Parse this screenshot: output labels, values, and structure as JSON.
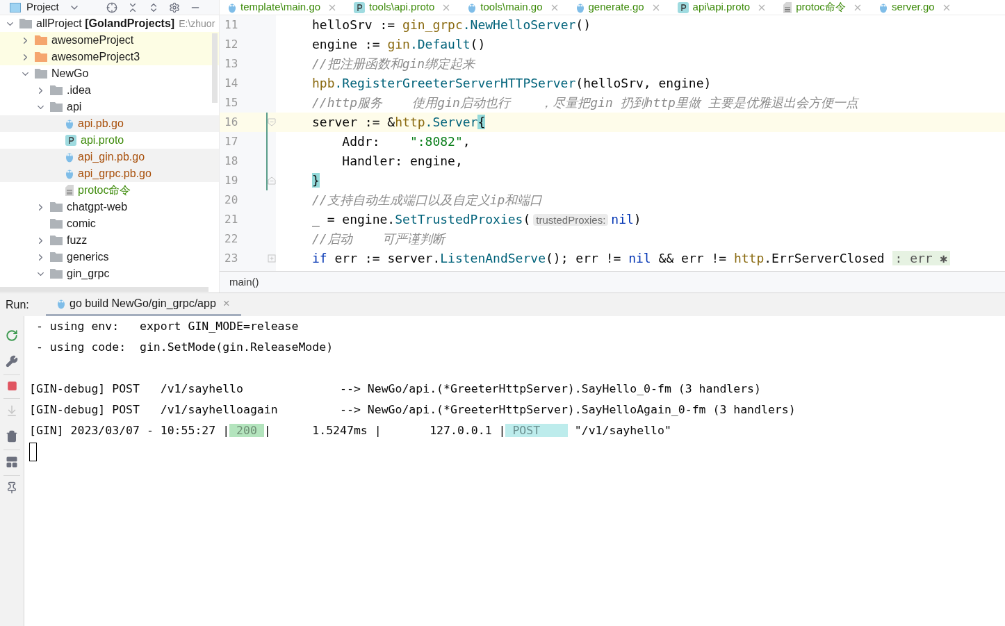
{
  "project_toolbar": {
    "title": "Project"
  },
  "editor_tabs": [
    {
      "label": "template\\main.go",
      "kind": "go",
      "color": "#3d8b0a"
    },
    {
      "label": "tools\\api.proto",
      "kind": "proto",
      "color": "#3d8b0a"
    },
    {
      "label": "tools\\main.go",
      "kind": "go",
      "color": "#3d8b0a"
    },
    {
      "label": "generate.go",
      "kind": "go",
      "color": "#3d8b0a"
    },
    {
      "label": "api\\api.proto",
      "kind": "proto",
      "color": "#3d8b0a"
    },
    {
      "label": "protoc命令",
      "kind": "text",
      "color": "#3d8b0a"
    },
    {
      "label": "server.go",
      "kind": "go",
      "color": "#3d8b0a"
    }
  ],
  "project_tree": [
    {
      "label": "allProject **[GolandProjects]**",
      "path": "E:\\zhuor",
      "kind": "folder",
      "expanded": true,
      "children": [
        {
          "label": "awesomeProject",
          "kind": "module",
          "expanded": false
        },
        {
          "label": "awesomeProject3",
          "kind": "module",
          "expanded": false
        },
        {
          "label": "NewGo",
          "kind": "folder",
          "expanded": true,
          "children": [
            {
              "label": ".idea",
              "kind": "folder",
              "expanded": false
            },
            {
              "label": "api",
              "kind": "folder",
              "expanded": true,
              "children": [
                {
                  "label": "api.pb.go",
                  "kind": "go",
                  "color": "#a84f0a",
                  "highlighted": true
                },
                {
                  "label": "api.proto",
                  "kind": "proto",
                  "color": "#3d8b0a",
                  "highlighted": false
                },
                {
                  "label": "api_gin.pb.go",
                  "kind": "go",
                  "color": "#a84f0a",
                  "highlighted": true
                },
                {
                  "label": "api_grpc.pb.go",
                  "kind": "go",
                  "color": "#a84f0a",
                  "highlighted": true
                },
                {
                  "label": "protoc命令",
                  "kind": "text",
                  "color": "#3d8b0a",
                  "highlighted": false
                }
              ]
            },
            {
              "label": "chatgpt-web",
              "kind": "folder",
              "expanded": false
            },
            {
              "label": "comic",
              "kind": "folder"
            },
            {
              "label": "fuzz",
              "kind": "folder",
              "expanded": false
            },
            {
              "label": "generics",
              "kind": "folder",
              "expanded": false
            },
            {
              "label": "gin_grpc",
              "kind": "folder",
              "expanded": true
            }
          ]
        }
      ]
    }
  ],
  "code_lines": [
    {
      "number": "11",
      "kind": "code",
      "current": false,
      "changed": false,
      "tokens": [
        {
          "t": "helloSrv := ",
          "kind": "plain"
        },
        {
          "t": "gin_grpc",
          "kind": "pkg"
        },
        {
          "t": ".NewHelloServer",
          "kind": "fn"
        },
        {
          "t": "()",
          "kind": "plain"
        }
      ]
    },
    {
      "number": "12",
      "kind": "code",
      "current": false,
      "changed": false,
      "tokens": [
        {
          "t": "engine := ",
          "kind": "plain"
        },
        {
          "t": "gin",
          "kind": "pkg"
        },
        {
          "t": ".Default",
          "kind": "fn"
        },
        {
          "t": "()",
          "kind": "plain"
        }
      ]
    },
    {
      "number": "13",
      "kind": "code",
      "current": false,
      "changed": false,
      "tokens": [
        {
          "t": "//把注册函数和gin绑定起来",
          "kind": "comment"
        }
      ]
    },
    {
      "number": "14",
      "kind": "code",
      "current": false,
      "changed": false,
      "tokens": [
        {
          "t": "hpb",
          "kind": "pkg"
        },
        {
          "t": ".RegisterGreeterServerHTTPServer",
          "kind": "fn"
        },
        {
          "t": "(helloSrv, engine)",
          "kind": "plain"
        }
      ]
    },
    {
      "number": "15",
      "kind": "code",
      "current": false,
      "changed": false,
      "tokens": [
        {
          "t": "//http服务    使用gin启动也行    ，尽量把gin 扔到http里做 主要是优雅退出会方便一点",
          "kind": "comment"
        }
      ]
    },
    {
      "number": "16",
      "kind": "fold-start",
      "current": true,
      "changed": true,
      "tokens": [
        {
          "t": "server := &",
          "kind": "plain"
        },
        {
          "t": "http",
          "kind": "pkg"
        },
        {
          "t": ".Server",
          "kind": "fn"
        },
        {
          "t": "{",
          "kind": "brace"
        }
      ]
    },
    {
      "number": "17",
      "kind": "code",
      "current": false,
      "changed": true,
      "tokens": [
        {
          "t": "    Addr:    ",
          "kind": "plain"
        },
        {
          "t": "\":8082\"",
          "kind": "string"
        },
        {
          "t": ",",
          "kind": "plain"
        }
      ]
    },
    {
      "number": "18",
      "kind": "code",
      "current": false,
      "changed": true,
      "tokens": [
        {
          "t": "    Handler: engine,",
          "kind": "plain"
        }
      ]
    },
    {
      "number": "19",
      "kind": "fold-end",
      "current": false,
      "changed": true,
      "tokens": [
        {
          "t": "}",
          "kind": "brace"
        }
      ]
    },
    {
      "number": "20",
      "kind": "code",
      "current": false,
      "changed": false,
      "tokens": [
        {
          "t": "//支持自动生成端口以及自定义ip和端口",
          "kind": "comment"
        }
      ]
    },
    {
      "number": "21",
      "kind": "code",
      "current": false,
      "changed": false,
      "tokens": [
        {
          "t": "_ = engine.",
          "kind": "plain"
        },
        {
          "t": "SetTrustedProxies",
          "kind": "fn"
        },
        {
          "t": "(",
          "kind": "plain"
        },
        {
          "t": "trustedProxies:",
          "kind": "hint"
        },
        {
          "t": "nil",
          "kind": "keyword"
        },
        {
          "t": ")",
          "kind": "plain"
        }
      ]
    },
    {
      "number": "22",
      "kind": "code",
      "current": false,
      "changed": false,
      "tokens": [
        {
          "t": "//启动    可严谨判断",
          "kind": "comment"
        }
      ]
    },
    {
      "number": "23",
      "kind": "collapsed",
      "current": false,
      "changed": false,
      "tokens": [
        {
          "t": "if",
          "kind": "keyword"
        },
        {
          "t": " err := server.",
          "kind": "plain"
        },
        {
          "t": "ListenAndServe",
          "kind": "fn"
        },
        {
          "t": "(); err != ",
          "kind": "plain"
        },
        {
          "t": "nil",
          "kind": "keyword"
        },
        {
          "t": " && err != ",
          "kind": "plain"
        },
        {
          "t": "http",
          "kind": "pkg"
        },
        {
          "t": ".ErrServerClosed ",
          "kind": "plain"
        },
        {
          "t": ": err ✱",
          "kind": "hint-green"
        }
      ]
    }
  ],
  "breadcrumb": "main()",
  "run_bar": {
    "label": "Run:",
    "tab": "go build NewGo/gin_grpc/app",
    "close": "×"
  },
  "console_toolbar": [
    {
      "kind": "rerun",
      "disabled": false,
      "separated": false
    },
    {
      "kind": "wrench",
      "disabled": false,
      "separated": false
    },
    {
      "kind": "stop",
      "disabled": false,
      "separated": true
    },
    {
      "kind": "scroll-end",
      "disabled": true,
      "separated": true
    },
    {
      "kind": "trash",
      "disabled": false,
      "separated": false
    },
    {
      "kind": "layout",
      "disabled": false,
      "separated": true
    },
    {
      "kind": "pin",
      "disabled": false,
      "separated": true
    }
  ],
  "console_lines": [
    {
      "kind": "mode-hint",
      "segments": [
        {
          "t": " - using env:   export GIN_MODE=release",
          "kind": "plain"
        }
      ]
    },
    {
      "kind": "mode-hint",
      "segments": [
        {
          "t": " - using code:  gin.SetMode(gin.ReleaseMode)",
          "kind": "plain"
        }
      ]
    },
    {
      "kind": "route",
      "segments": [
        {
          "t": "[GIN-debug] POST   /v1/sayhello              --> NewGo/api.(*GreeterHttpServer).SayHello_0-fm (3 handlers)",
          "kind": "plain"
        }
      ]
    },
    {
      "kind": "route",
      "segments": [
        {
          "t": "[GIN-debug] POST   /v1/sayhelloagain         --> NewGo/api.(*GreeterHttpServer).SayHelloAgain_0-fm (3 handlers)",
          "kind": "plain"
        }
      ]
    },
    {
      "kind": "request",
      "segments": [
        {
          "t": "[GIN] 2023/03/07 - 10:55:27 |",
          "kind": "plain"
        },
        {
          "t": " 200 ",
          "kind": "status"
        },
        {
          "t": "|      1.5247ms |       127.0.0.1 |",
          "kind": "plain"
        },
        {
          "t": " POST    ",
          "kind": "method"
        },
        {
          "t": " \"/v1/sayhello\"",
          "kind": "plain"
        }
      ]
    }
  ]
}
